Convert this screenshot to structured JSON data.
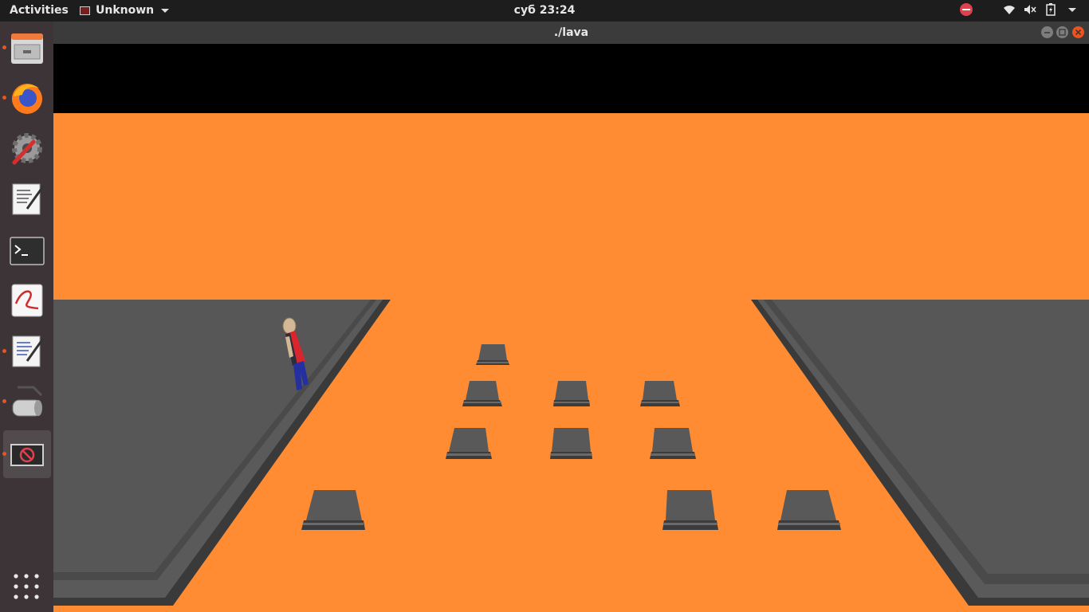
{
  "topbar": {
    "activities": "Activities",
    "app_name": "Unknown",
    "clock": "суб 23:24"
  },
  "dock": {
    "items": [
      {
        "name": "files-app",
        "running": true
      },
      {
        "name": "firefox",
        "running": true
      },
      {
        "name": "system-settings",
        "running": false
      },
      {
        "name": "text-editor",
        "running": false
      },
      {
        "name": "terminal",
        "running": false
      },
      {
        "name": "document-viewer",
        "running": false
      },
      {
        "name": "text-editor-2",
        "running": true
      },
      {
        "name": "disk-utility",
        "running": true
      },
      {
        "name": "unknown-app",
        "running": true,
        "active": true
      }
    ],
    "apps_grid": "show-applications-icon"
  },
  "window": {
    "title": "./lava"
  },
  "colors": {
    "lava": "#ff8c33",
    "platform": "#575757",
    "accent": "#e95420"
  }
}
